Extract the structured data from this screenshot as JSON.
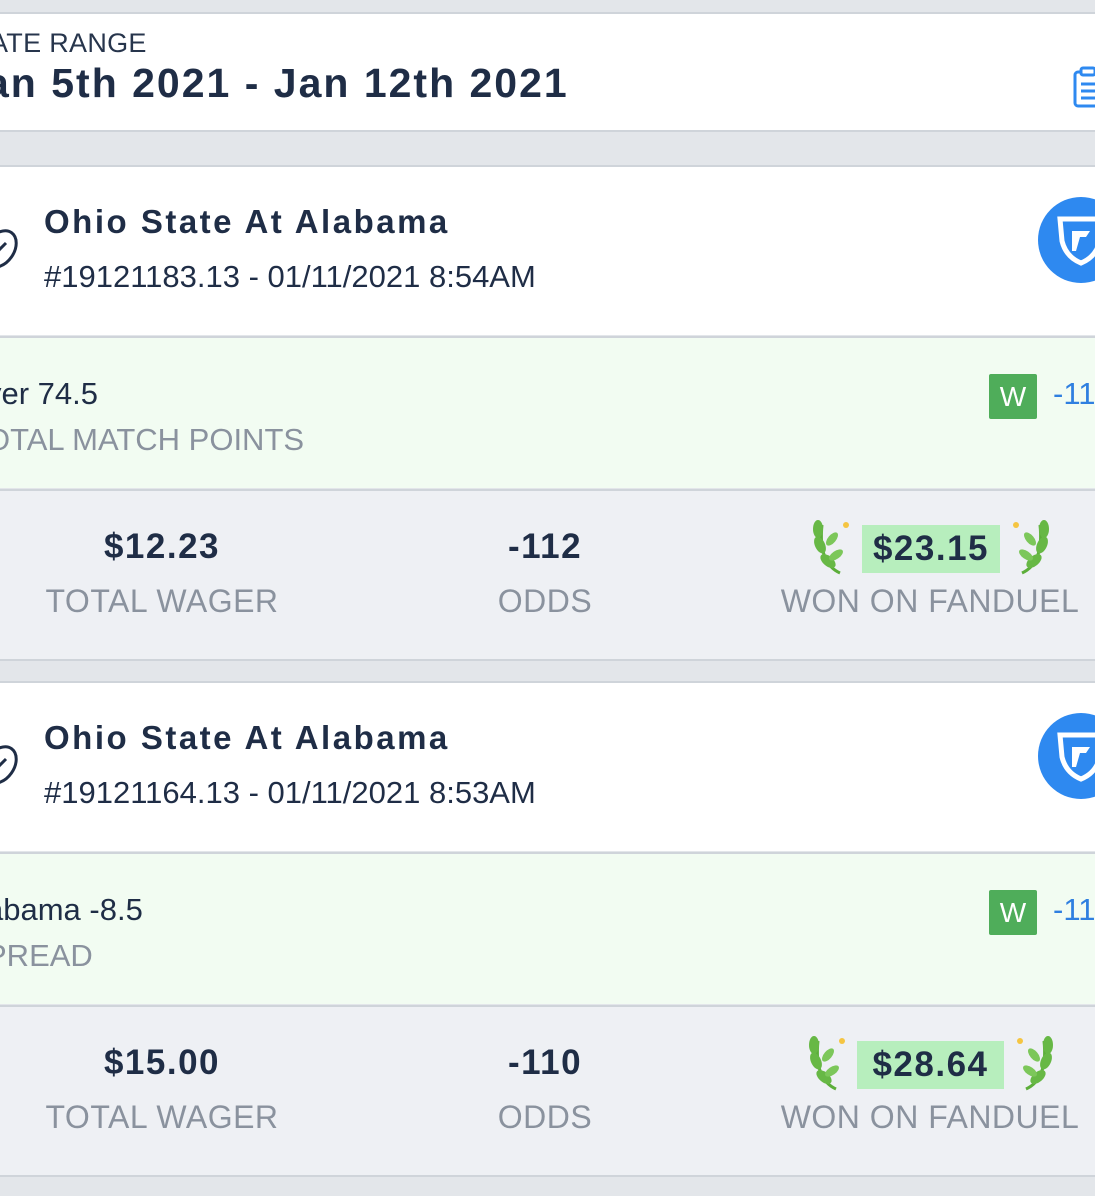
{
  "date_range": {
    "label": "ATE RANGE",
    "value": "an 5th 2021 - Jan 12th 2021"
  },
  "colors": {
    "win_badge": "#4fad5a",
    "odds_link": "#2f7fe0",
    "fanduel_blue": "#2e89f0",
    "won_highlight": "#b7eebd",
    "pick_row_bg": "#f2fcf2"
  },
  "bets": [
    {
      "game": "Ohio State At Alabama",
      "meta": "#19121183.13 - 01/11/2021 8:54AM",
      "league_icon": "football-icon",
      "book_icon": "fanduel-shield-icon",
      "pick": "ver 74.5",
      "market": "OTAL MATCH POINTS",
      "result_badge": "W",
      "pick_odds": "-11",
      "wager": "$12.23",
      "wager_label": "TOTAL WAGER",
      "odds": "-112",
      "odds_label": "ODDS",
      "won": "$23.15",
      "won_label": "WON ON FANDUEL"
    },
    {
      "game": "Ohio State At Alabama",
      "meta": "#19121164.13 - 01/11/2021 8:53AM",
      "league_icon": "football-icon",
      "book_icon": "fanduel-shield-icon",
      "pick": "abama -8.5",
      "market": "PREAD",
      "result_badge": "W",
      "pick_odds": "-11",
      "wager": "$15.00",
      "wager_label": "TOTAL WAGER",
      "odds": "-110",
      "odds_label": "ODDS",
      "won": "$28.64",
      "won_label": "WON ON FANDUEL"
    }
  ]
}
